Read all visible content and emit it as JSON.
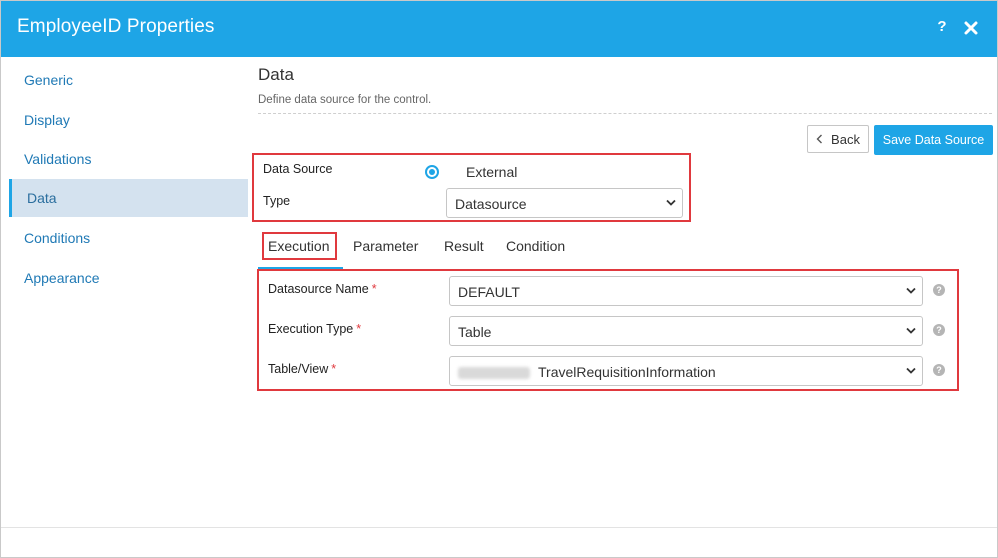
{
  "dialog": {
    "title": "EmployeeID Properties",
    "help_label": "?",
    "close_icon": "close-icon"
  },
  "sidebar": {
    "items": [
      {
        "label": "Generic"
      },
      {
        "label": "Display"
      },
      {
        "label": "Validations"
      },
      {
        "label": "Data",
        "active": true
      },
      {
        "label": "Conditions"
      },
      {
        "label": "Appearance"
      }
    ]
  },
  "section": {
    "title": "Data",
    "description": "Define data source for the control."
  },
  "toolbar": {
    "back_label": "Back",
    "save_label": "Save Data Source"
  },
  "source": {
    "data_source_label": "Data Source",
    "data_source_option": "External",
    "type_label": "Type",
    "type_value": "Datasource"
  },
  "tabs": [
    {
      "label": "Execution",
      "active": true
    },
    {
      "label": "Parameter"
    },
    {
      "label": "Result"
    },
    {
      "label": "Condition"
    }
  ],
  "execution": {
    "required_mark": "*",
    "datasource_name_label": "Datasource Name",
    "datasource_name_value": "DEFAULT",
    "execution_type_label": "Execution Type",
    "execution_type_value": "Table",
    "table_view_label": "Table/View",
    "table_view_value": "TravelRequisitionInformation",
    "help_label": "?"
  },
  "colors": {
    "accent": "#1ea5e6",
    "highlight_box": "#e0393e",
    "active_nav_bg": "#d4e2ef"
  }
}
